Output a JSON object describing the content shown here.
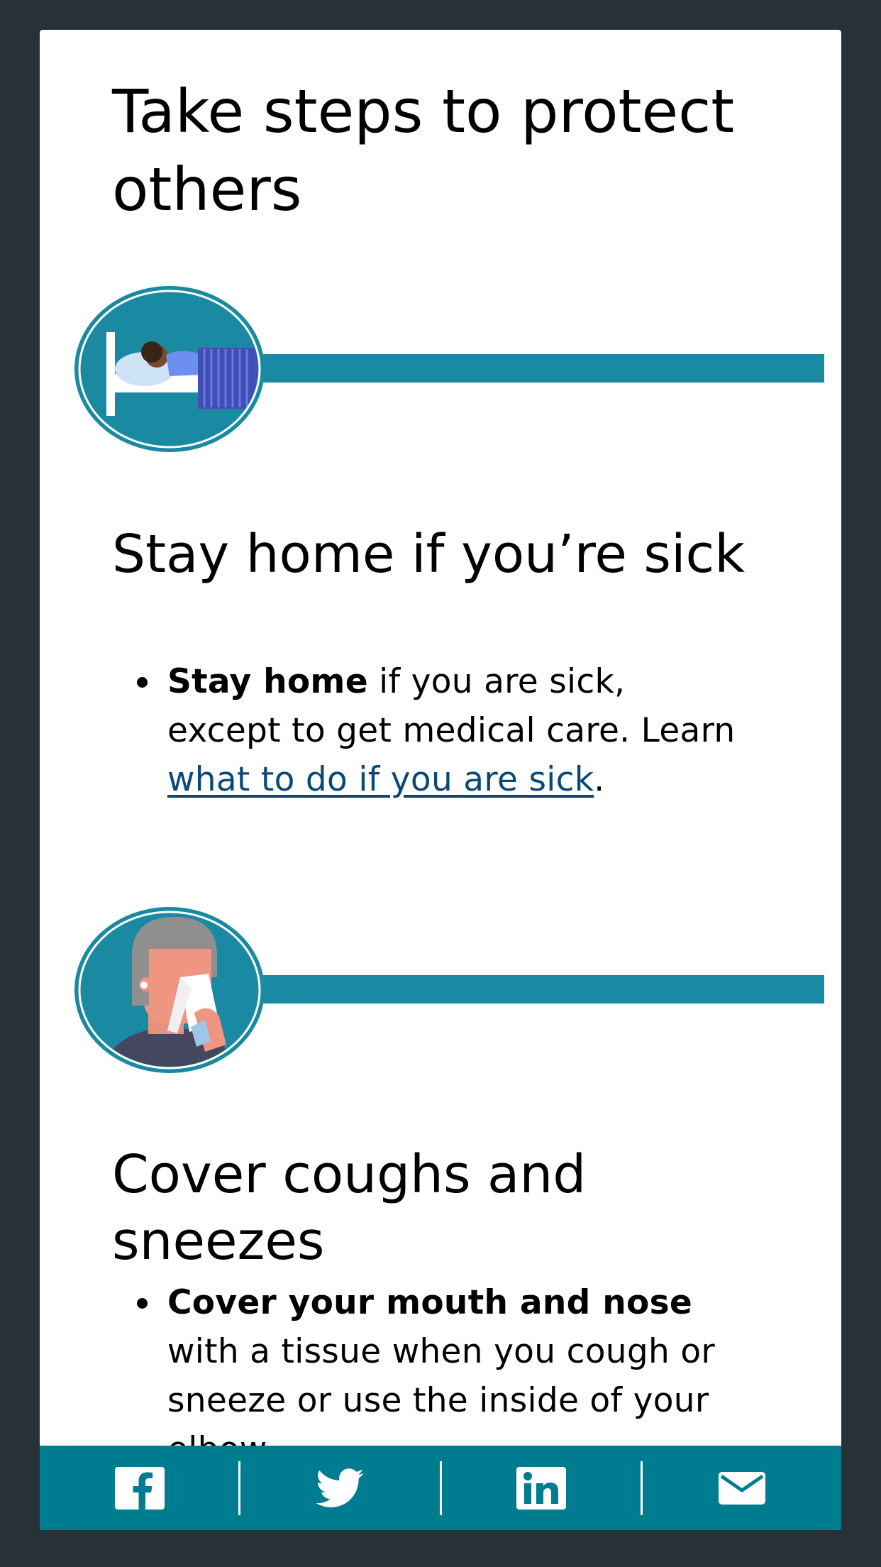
{
  "page": {
    "title": "Take steps to protect others"
  },
  "sections": [
    {
      "icon": "person-sick-in-bed-icon",
      "title": "Stay home if you’re sick",
      "bullet": {
        "strong": "Stay home",
        "text_before_link": " if you are sick, except to get medical care. Learn ",
        "link": "what to do if you are sick",
        "text_after_link": "."
      }
    },
    {
      "icon": "person-covering-sneeze-icon",
      "title": "Cover coughs and sneezes",
      "bullet": {
        "strong": "Cover your mouth and nose",
        "text": " with a tissue when you cough or sneeze or use the inside of your elbow."
      }
    }
  ],
  "share": {
    "items": [
      {
        "name": "facebook",
        "icon": "facebook-icon"
      },
      {
        "name": "twitter",
        "icon": "twitter-icon"
      },
      {
        "name": "linkedin",
        "icon": "linkedin-icon"
      },
      {
        "name": "email",
        "icon": "email-icon"
      }
    ]
  },
  "colors": {
    "background": "#263238",
    "teal": "#1a8aa3",
    "share_bar": "#007c91",
    "link": "#0b4778"
  }
}
